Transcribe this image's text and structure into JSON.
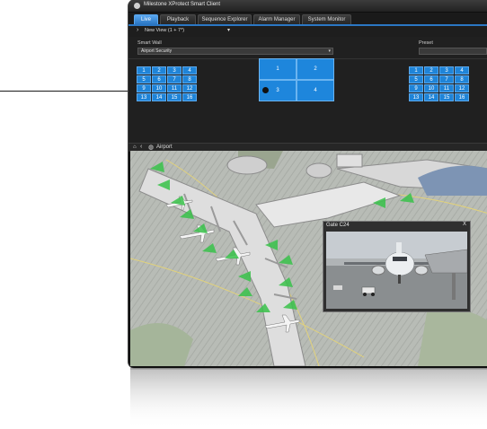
{
  "app": {
    "title": "Milestone XProtect Smart Client"
  },
  "tabs": [
    {
      "label": "Live",
      "active": true
    },
    {
      "label": "Playback",
      "active": false
    },
    {
      "label": "Sequence Explorer",
      "active": false
    },
    {
      "label": "Alarm Manager",
      "active": false
    },
    {
      "label": "System Monitor",
      "active": false
    }
  ],
  "viewbar": {
    "current_view": "New View (1 + 7*)"
  },
  "smart_wall": {
    "label": "Smart Wall",
    "selected": "Airport Security",
    "preset_label": "Preset",
    "left_grid": [
      "1",
      "2",
      "3",
      "4",
      "5",
      "6",
      "7",
      "8",
      "9",
      "10",
      "11",
      "12",
      "13",
      "14",
      "15",
      "16"
    ],
    "right_grid": [
      "1",
      "2",
      "3",
      "4",
      "5",
      "6",
      "7",
      "8",
      "9",
      "10",
      "11",
      "12",
      "13",
      "14",
      "15",
      "16"
    ],
    "monitors": [
      "1",
      "2",
      "3",
      "4"
    ]
  },
  "map": {
    "breadcrumb": "Airport"
  },
  "camera_popup": {
    "title": "Gate C24",
    "close": "X"
  },
  "colors": {
    "accent": "#1f84d8",
    "tab_active": "#3b8fdd",
    "camera_cone": "#39c24a"
  },
  "icons": [
    "home-icon",
    "back-icon",
    "globe-icon",
    "close-icon",
    "chevron-right-icon",
    "caret-down-icon"
  ]
}
